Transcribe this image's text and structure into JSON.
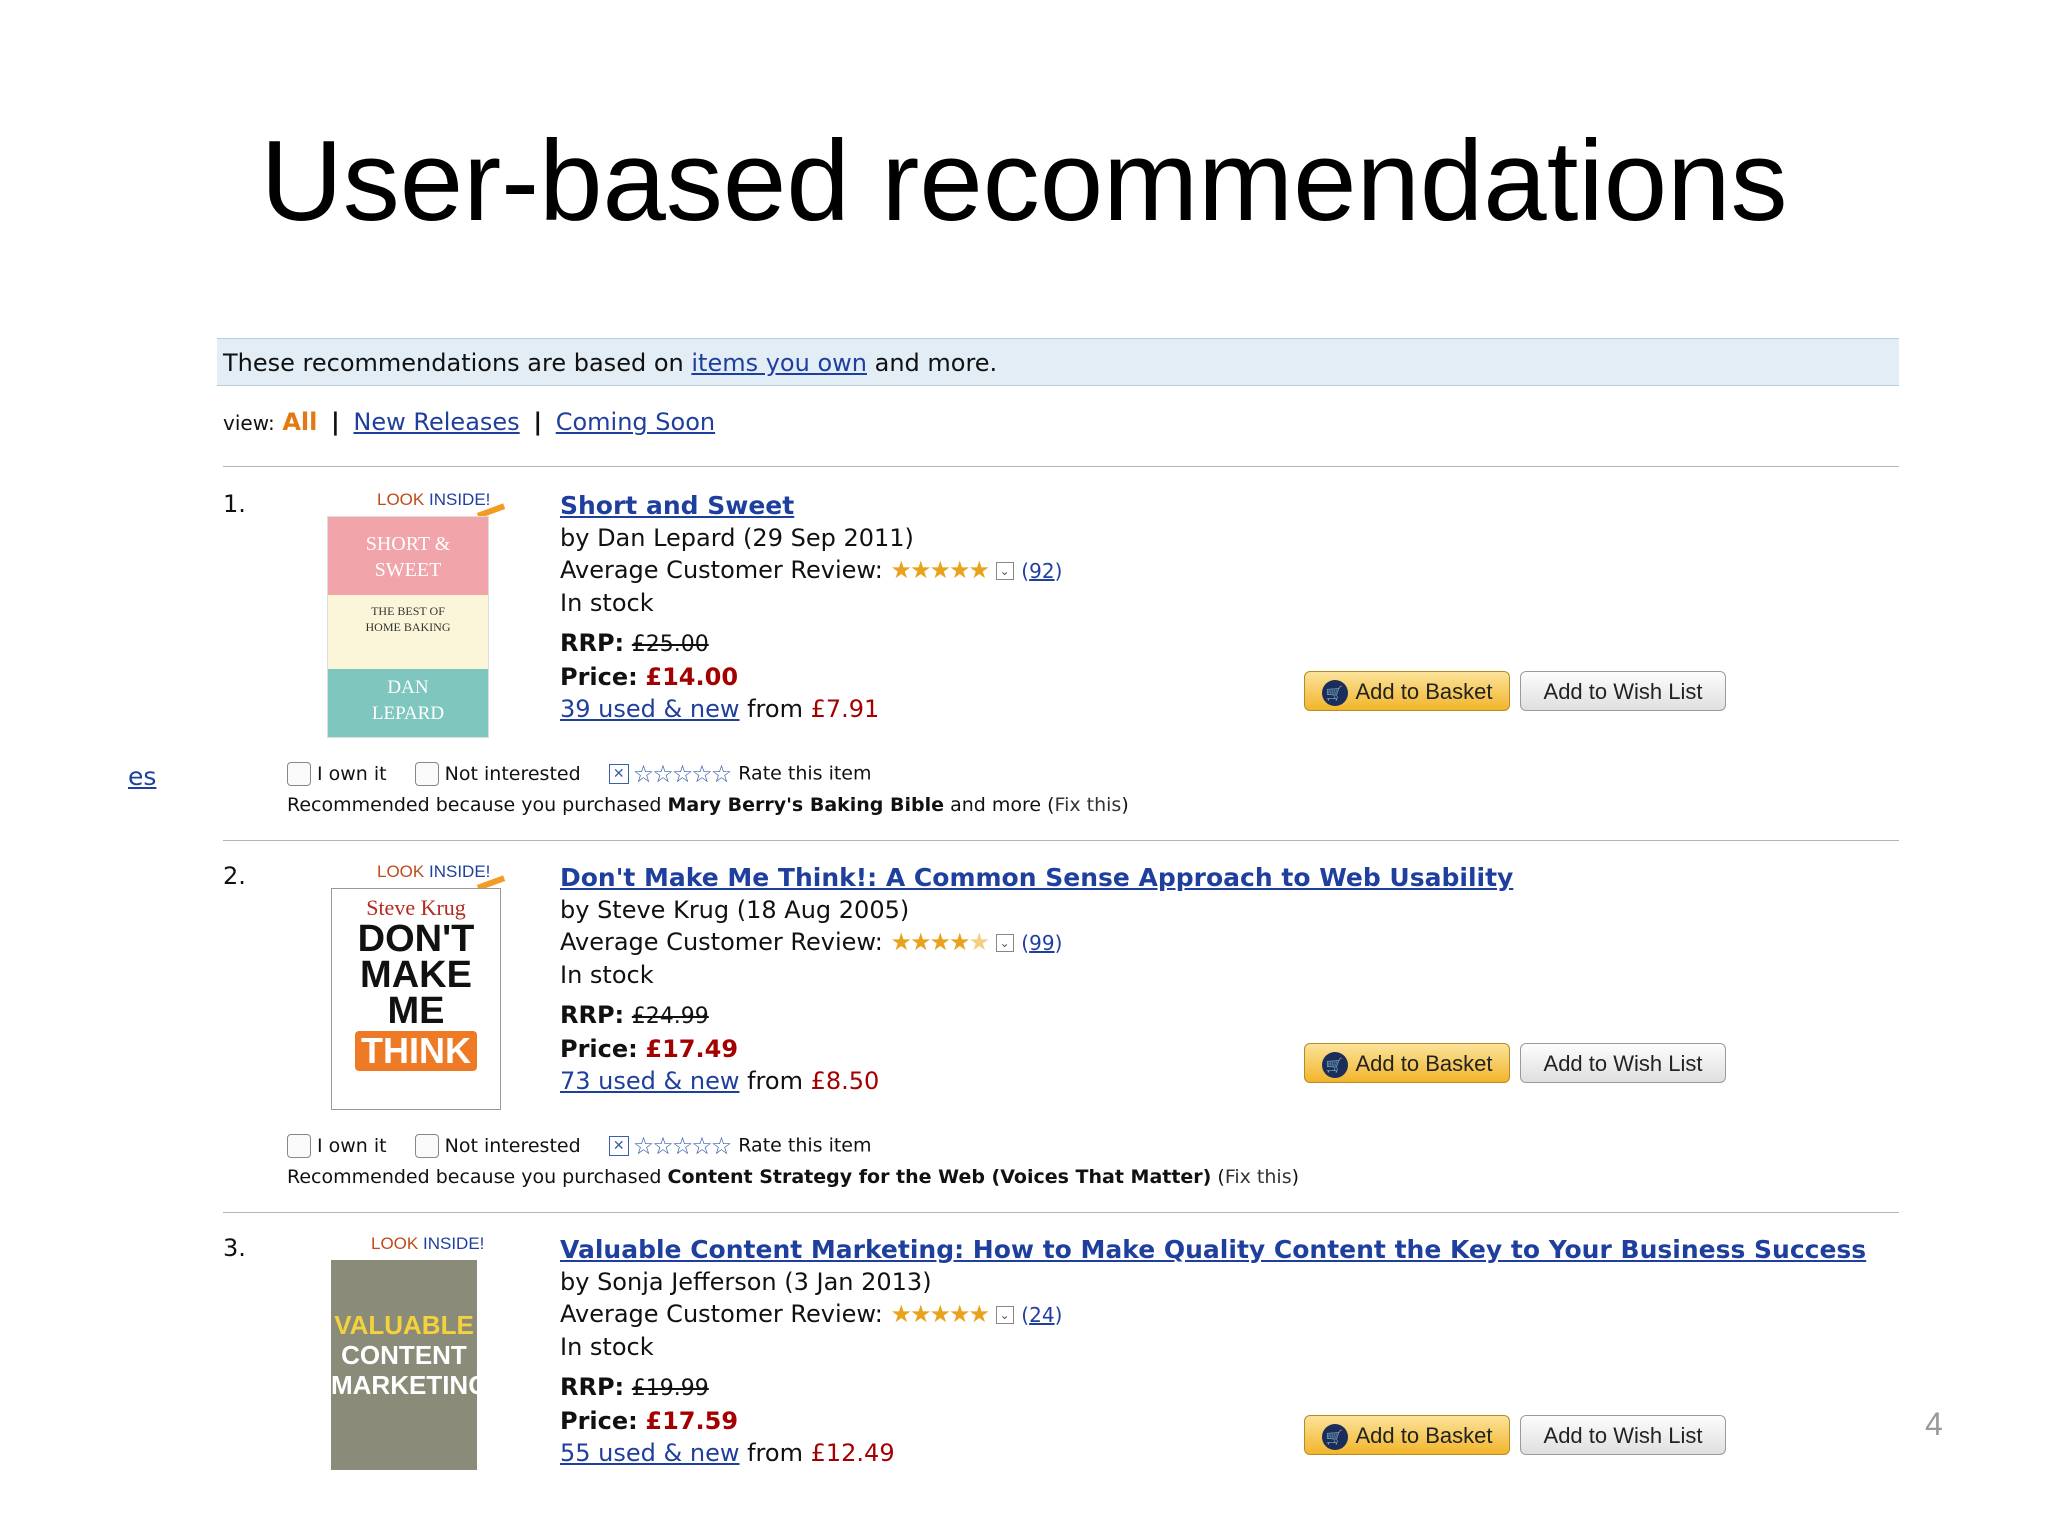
{
  "slide": {
    "title": "User-based recommendations",
    "page_number": "4",
    "edge_link": "es"
  },
  "banner": {
    "prefix": "These recommendations are based on",
    "link": "items you own",
    "suffix": "and more."
  },
  "view": {
    "label": "view:",
    "all": "All",
    "new_releases": "New Releases",
    "coming_soon": "Coming Soon",
    "sep": "|"
  },
  "common": {
    "look_inside_1": "LOOK",
    "look_inside_2": "INSIDE!",
    "avg_review_label": "Average Customer Review:",
    "rrp_label": "RRP:",
    "price_label": "Price:",
    "from_label": "from",
    "add_to_basket": "Add to Basket",
    "add_to_wish_list": "Add to Wish List",
    "i_own_it": "I own it",
    "not_interested": "Not interested",
    "rate_this_item": "Rate this item",
    "recommended_prefix": "Recommended because you purchased",
    "fix_this": "Fix this",
    "stars_full": "★★★★★",
    "stars_empty": "☆☆☆☆☆",
    "accent_orange": "#e47911",
    "link_blue": "#1f3f9e",
    "price_red": "#a50000"
  },
  "items": [
    {
      "rank": "1.",
      "title": "Short and Sweet",
      "byline": "by Dan Lepard (29 Sep 2011)",
      "rating": 5,
      "review_count": "92",
      "availability": "In stock",
      "rrp": "£25.00",
      "price": "£14.00",
      "used_new": "39 used & new",
      "used_from": "£7.91",
      "reason_book": "Mary Berry's Baking Bible",
      "reason_suffix": "and more",
      "cover": {
        "line1": "SHORT &",
        "line2": "SWEET",
        "line3": "THE BEST OF",
        "line4": "HOME BAKING",
        "line5": "DAN",
        "line6": "LEPARD"
      }
    },
    {
      "rank": "2.",
      "title": "Don't Make Me Think!: A Common Sense Approach to Web Usability",
      "byline": "by Steve Krug (18 Aug 2005)",
      "rating": 4.5,
      "review_count": "99",
      "availability": "In stock",
      "rrp": "£24.99",
      "price": "£17.49",
      "used_new": "73 used & new",
      "used_from": "£8.50",
      "reason_book": "Content Strategy for the Web (Voices That Matter)",
      "reason_suffix": "",
      "cover": {
        "line1": "Steve Krug",
        "line2": "DON'T",
        "line3": "MAKE",
        "line4": "ME",
        "line5": "THINK"
      }
    },
    {
      "rank": "3.",
      "title": "Valuable Content Marketing: How to Make Quality Content the Key to Your Business Success",
      "byline": "by Sonja Jefferson (3 Jan 2013)",
      "rating": 5,
      "review_count": "24",
      "availability": "In stock",
      "rrp": "£19.99",
      "price": "£17.59",
      "used_new": "55 used & new",
      "used_from": "£12.49",
      "cover": {
        "line1": "VALUABLE",
        "line2": "CONTENT",
        "line3": "MARKETING"
      }
    }
  ]
}
